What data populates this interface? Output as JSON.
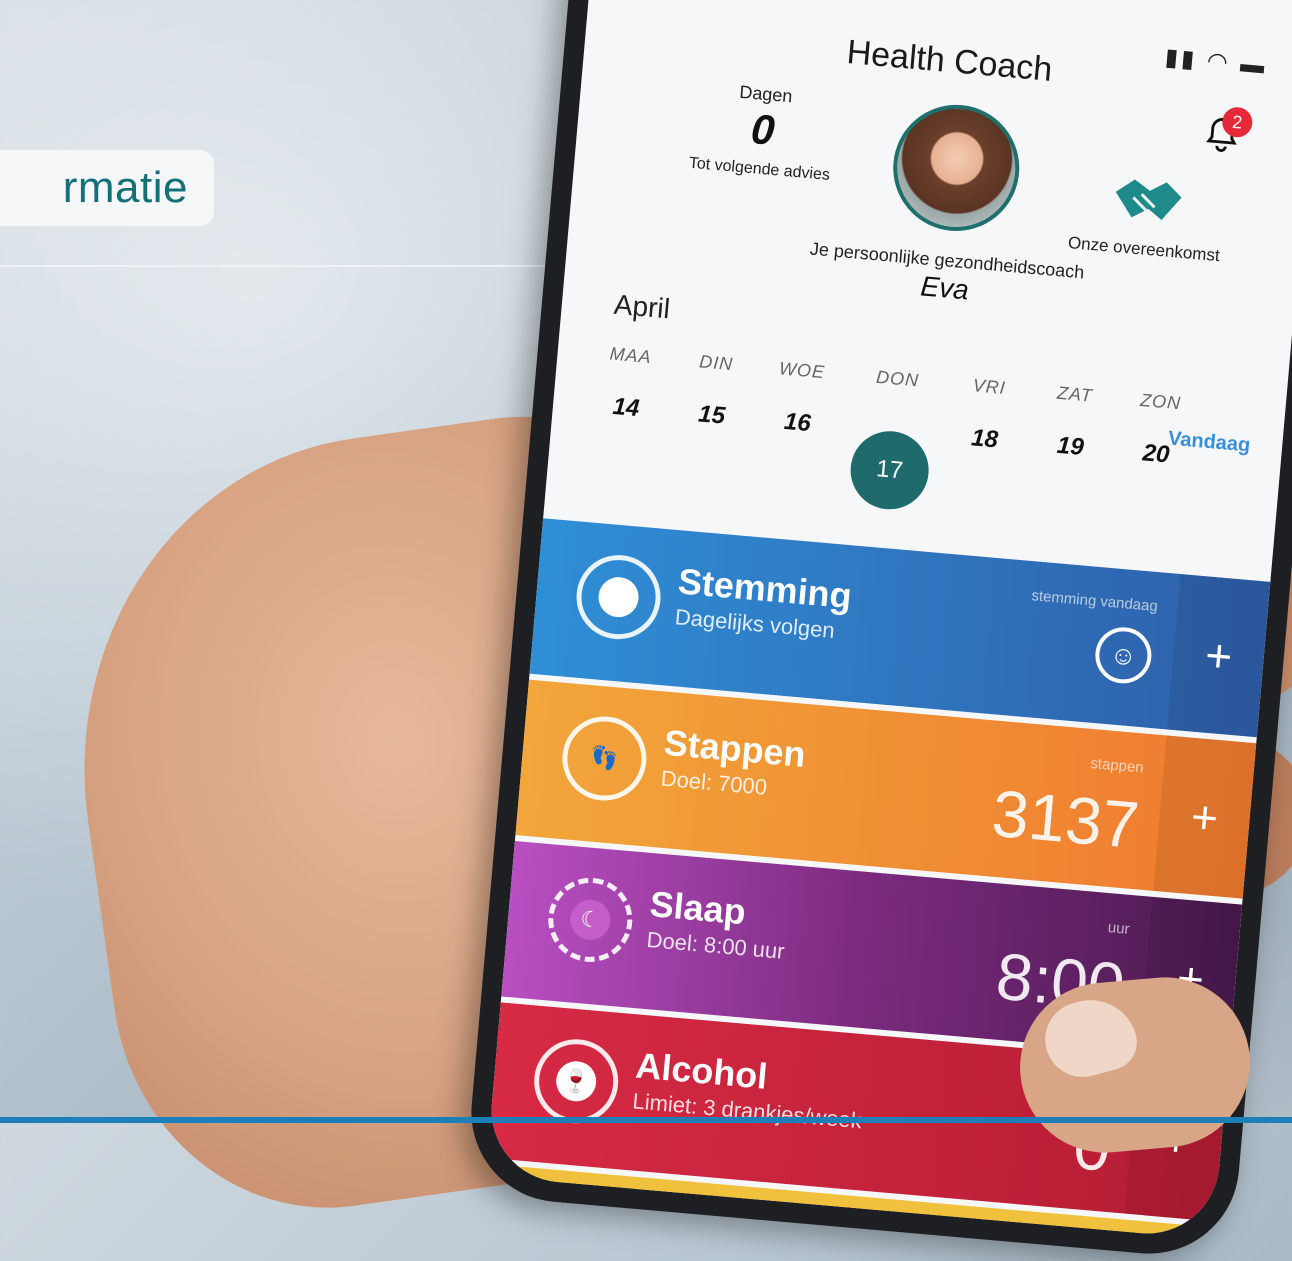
{
  "banner": {
    "text": "rmatie"
  },
  "app": {
    "title": "Health Coach",
    "notification_count": "2",
    "days": {
      "label": "Dagen",
      "value": "0",
      "sub": "Tot volgende advies"
    },
    "coach": {
      "label": "Je persoonlijke gezondheidscoach",
      "name": "Eva"
    },
    "agreement": "Onze overeenkomst",
    "calendar": {
      "month": "April",
      "today_label": "Vandaag",
      "days": [
        {
          "name": "MAA",
          "date": "14"
        },
        {
          "name": "DIN",
          "date": "15"
        },
        {
          "name": "WOE",
          "date": "16"
        },
        {
          "name": "DON",
          "date": "17"
        },
        {
          "name": "VRI",
          "date": "18"
        },
        {
          "name": "ZAT",
          "date": "19"
        },
        {
          "name": "ZON",
          "date": "20"
        }
      ]
    },
    "cards": [
      {
        "title": "Stemming",
        "sub": "Dagelijks volgen",
        "unit": "stemming vandaag",
        "value": "",
        "plus": "+"
      },
      {
        "title": "Stappen",
        "sub": "Doel: 7000",
        "unit": "stappen",
        "value": "3137",
        "plus": "+"
      },
      {
        "title": "Slaap",
        "sub": "Doel: 8:00 uur",
        "unit": "uur",
        "value": "8:00",
        "plus": "+"
      },
      {
        "title": "Alcohol",
        "sub": "Limiet: 3 drankjes/week",
        "unit": "drankjes",
        "value": "0",
        "plus": "+"
      }
    ]
  },
  "colors": {
    "accent_teal": "#1f6a6b",
    "stemming": "#2f7cc8",
    "stappen": "#f08f33",
    "slaap": "#8a2f8e",
    "alcohol": "#c9243e",
    "link_blue": "#3a8fd8"
  }
}
